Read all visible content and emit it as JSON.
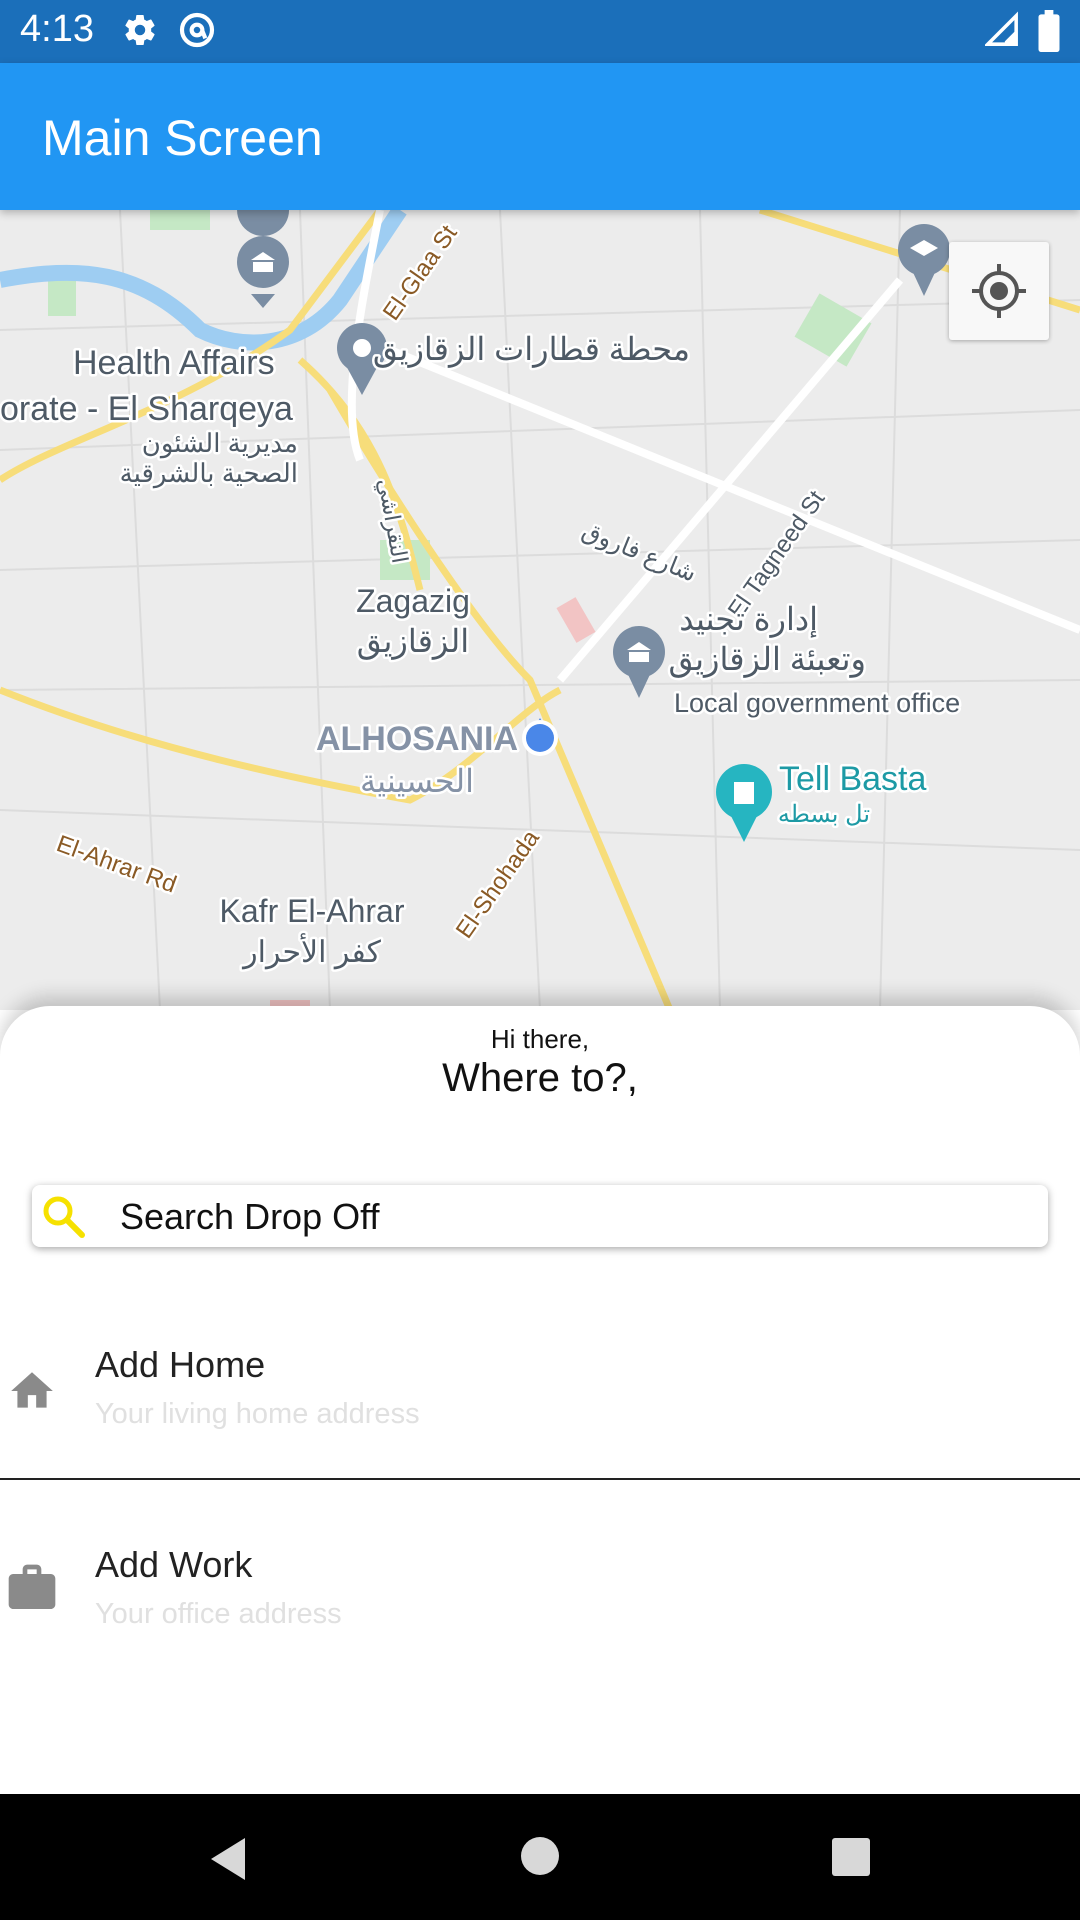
{
  "status_bar": {
    "time": "4:13",
    "icons": [
      "gear-icon",
      "at-sign-icon",
      "signal-icon",
      "battery-icon"
    ]
  },
  "app_bar": {
    "title": "Main Screen",
    "color": "#2196f3"
  },
  "map": {
    "labels": {
      "health_affairs": "Health Affairs",
      "directorate": "orate - El Sharqeya",
      "directorate_ar_1": "مديرية الشئون",
      "directorate_ar_2": "الصحية بالشرقية",
      "el_glaa": "El-Glaa St",
      "station_ar": "محطة قطارات الزقازيق",
      "zagazig": "Zagazig",
      "zagazig_ar": "الزقازيق",
      "nabarawy_ar": "النقراشي",
      "farouk_st_ar": "شارع فاروق",
      "el_tagneed": "El Tagneed St",
      "admin_ar_1": "إدارة تجنيد",
      "admin_ar_2": "وتعبئة الزقازيق",
      "local_gov": "Local government office",
      "alhosania": "ALHOSANIA",
      "alhosania_ar": "الحسينية",
      "tell_basta": "Tell Basta",
      "tell_basta_ar": "تل بسطه",
      "el_ahrar_rd": "El-Ahrar Rd",
      "kafr_el_ahrar": "Kafr El-Ahrar",
      "kafr_el_ahrar_ar": "كفر الأحرار",
      "el_shohada": "El-Shohada"
    }
  },
  "sheet": {
    "greeting": "Hi there,",
    "question": "Where to?,",
    "search_label": "Search Drop Off",
    "options": [
      {
        "title": "Add Home",
        "subtitle": "Your living home address",
        "icon": "home-icon"
      },
      {
        "title": "Add Work",
        "subtitle": "Your office address",
        "icon": "briefcase-icon"
      }
    ]
  },
  "nav_bar": {
    "buttons": [
      "back-button",
      "home-button",
      "recents-button"
    ]
  }
}
